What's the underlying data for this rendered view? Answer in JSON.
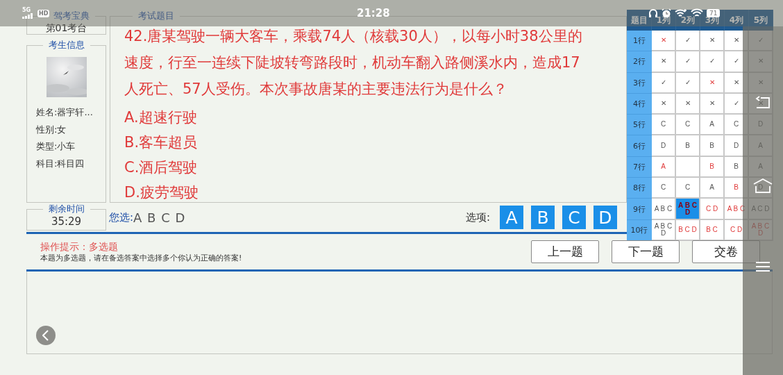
{
  "status_bar": {
    "network": "5G",
    "hd": "HD",
    "time": "21:28",
    "battery": "71"
  },
  "station": {
    "legend": "驾考宝典",
    "value": "第01考台"
  },
  "candidate": {
    "legend": "考生信息",
    "photo": {
      "kind": "picture"
    },
    "fields": [
      "姓名:器宇轩...",
      "性别:女",
      "类型:小车",
      "科目:科目四"
    ]
  },
  "timer": {
    "legend": "剩余时间",
    "value": "35:29"
  },
  "question": {
    "legend": "考试题目",
    "text": "42.唐某驾驶一辆大客车，乘载74人（核载30人），以每小时38公里的速度，行至一连续下陡坡转弯路段时，机动车翻入路侧溪水内，造成17人死亡、57人受伤。本次事故唐某的主要违法行为是什么？",
    "options": [
      "A.超速行驶",
      "B.客车超员",
      "C.酒后驾驶",
      "D.疲劳驾驶"
    ]
  },
  "your_choice": {
    "label": "您选:",
    "value": "A B C D"
  },
  "option_buttons": {
    "label": "选项:",
    "buttons": [
      "A",
      "B",
      "C",
      "D"
    ]
  },
  "hint": {
    "title": "操作提示：多选题",
    "text": "本题为多选题，请在备选答案中选择多个你认为正确的答案!"
  },
  "nav_buttons": [
    "上一题",
    "下一题",
    "交卷"
  ],
  "answer_grid": {
    "corner": "题目",
    "columns": [
      "1列",
      "2列",
      "3列",
      "4列",
      "5列"
    ],
    "rows": [
      {
        "label": "1行",
        "cells": [
          {
            "text": "✕",
            "wrong": true,
            "selected": false
          },
          {
            "text": "✓",
            "wrong": false,
            "selected": false
          },
          {
            "text": "✕",
            "wrong": false,
            "selected": false
          },
          {
            "text": "✕",
            "wrong": false,
            "selected": false
          },
          {
            "text": "✓",
            "wrong": false,
            "selected": false
          }
        ]
      },
      {
        "label": "2行",
        "cells": [
          {
            "text": "✕",
            "wrong": false,
            "selected": false
          },
          {
            "text": "✓",
            "wrong": false,
            "selected": false
          },
          {
            "text": "✓",
            "wrong": false,
            "selected": false
          },
          {
            "text": "✓",
            "wrong": false,
            "selected": false
          },
          {
            "text": "✕",
            "wrong": false,
            "selected": false
          }
        ]
      },
      {
        "label": "3行",
        "cells": [
          {
            "text": "✓",
            "wrong": false,
            "selected": false
          },
          {
            "text": "✓",
            "wrong": false,
            "selected": false
          },
          {
            "text": "✕",
            "wrong": true,
            "selected": false
          },
          {
            "text": "✕",
            "wrong": false,
            "selected": false
          },
          {
            "text": "✕",
            "wrong": false,
            "selected": false
          }
        ]
      },
      {
        "label": "4行",
        "cells": [
          {
            "text": "✕",
            "wrong": false,
            "selected": false
          },
          {
            "text": "✕",
            "wrong": false,
            "selected": false
          },
          {
            "text": "✕",
            "wrong": false,
            "selected": false
          },
          {
            "text": "✓",
            "wrong": false,
            "selected": false
          },
          {
            "text": "✕",
            "wrong": false,
            "selected": false
          }
        ]
      },
      {
        "label": "5行",
        "cells": [
          {
            "text": "C",
            "wrong": false,
            "selected": false
          },
          {
            "text": "C",
            "wrong": false,
            "selected": false
          },
          {
            "text": "A",
            "wrong": false,
            "selected": false
          },
          {
            "text": "C",
            "wrong": false,
            "selected": false
          },
          {
            "text": "D",
            "wrong": false,
            "selected": false
          }
        ]
      },
      {
        "label": "6行",
        "cells": [
          {
            "text": "D",
            "wrong": false,
            "selected": false
          },
          {
            "text": "B",
            "wrong": false,
            "selected": false
          },
          {
            "text": "B",
            "wrong": false,
            "selected": false
          },
          {
            "text": "D",
            "wrong": false,
            "selected": false
          },
          {
            "text": "A",
            "wrong": false,
            "selected": false
          }
        ]
      },
      {
        "label": "7行",
        "cells": [
          {
            "text": "A",
            "wrong": true,
            "selected": false
          },
          {
            "selected": false
          },
          {
            "text": "B",
            "wrong": true,
            "selected": false
          },
          {
            "text": "B",
            "wrong": false,
            "selected": false
          },
          {
            "text": "A",
            "wrong": false,
            "selected": false
          }
        ]
      },
      {
        "label": "8行",
        "cells": [
          {
            "text": "C",
            "wrong": false,
            "selected": false
          },
          {
            "text": "C",
            "wrong": false,
            "selected": false
          },
          {
            "text": "A",
            "wrong": false,
            "selected": false
          },
          {
            "text": "B",
            "wrong": true,
            "selected": false
          },
          {
            "text": "D",
            "wrong": false,
            "selected": false
          }
        ]
      },
      {
        "label": "9行",
        "cells": [
          {
            "text": "A B C",
            "wrong": false,
            "selected": false
          },
          {
            "text": "A B C D",
            "wrong": true,
            "selected": true
          },
          {
            "text": "C D",
            "wrong": true,
            "selected": false
          },
          {
            "text": "A B C",
            "wrong": true,
            "selected": false
          },
          {
            "text": "A C D",
            "wrong": false,
            "selected": false
          }
        ]
      },
      {
        "label": "10行",
        "cells": [
          {
            "text": "A B C D",
            "wrong": false,
            "selected": false
          },
          {
            "text": "B C D",
            "wrong": true,
            "selected": false
          },
          {
            "text": "B C",
            "wrong": true,
            "selected": false
          },
          {
            "text": "C D",
            "wrong": true,
            "selected": false
          },
          {
            "text": "A B C D",
            "wrong": true,
            "selected": false
          }
        ]
      }
    ]
  }
}
